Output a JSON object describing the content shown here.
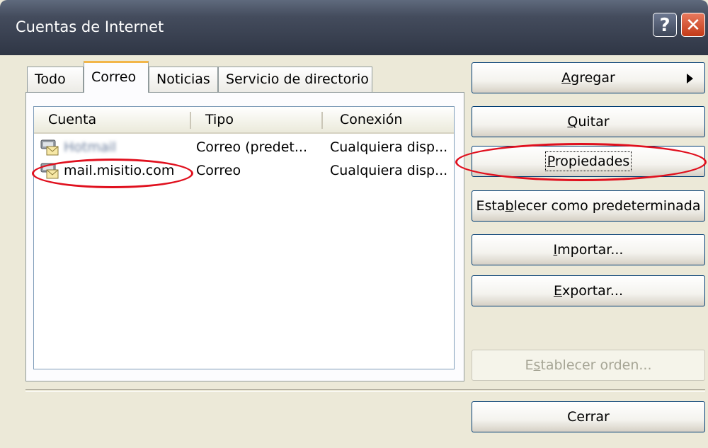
{
  "window": {
    "title": "Cuentas de Internet",
    "help_label": "?",
    "close_label": "✕"
  },
  "tabs": [
    {
      "label": "Todo",
      "active": false
    },
    {
      "label": "Correo",
      "active": true
    },
    {
      "label": "Noticias",
      "active": false
    },
    {
      "label": "Servicio de directorio",
      "active": false
    }
  ],
  "list": {
    "columns": [
      "Cuenta",
      "Tipo",
      "Conexión"
    ],
    "rows": [
      {
        "icon": "mail-account-icon",
        "account": "Hotmail",
        "type": "Correo (predet...",
        "connection": "Cualquiera disp..."
      },
      {
        "icon": "mail-account-icon",
        "account": "mail.misitio.com",
        "type": "Correo",
        "connection": "Cualquiera disp..."
      }
    ]
  },
  "buttons": {
    "add": {
      "pre": "",
      "u": "A",
      "post": "gregar"
    },
    "remove": {
      "pre": "",
      "u": "Q",
      "post": "uitar"
    },
    "properties": {
      "pre": "",
      "u": "P",
      "post": "ropiedades"
    },
    "set_default": {
      "pre": "Esta",
      "u": "b",
      "post": "lecer como predeterminada"
    },
    "import": {
      "pre": "",
      "u": "I",
      "post": "mportar..."
    },
    "export": {
      "pre": "",
      "u": "E",
      "post": "xportar..."
    },
    "set_order": {
      "pre": "E",
      "u": "s",
      "post": "tablecer orden..."
    },
    "close": {
      "label": "Cerrar"
    }
  },
  "colors": {
    "annotation": "#e0101e",
    "active_tab_accent": "#f2b64a"
  }
}
